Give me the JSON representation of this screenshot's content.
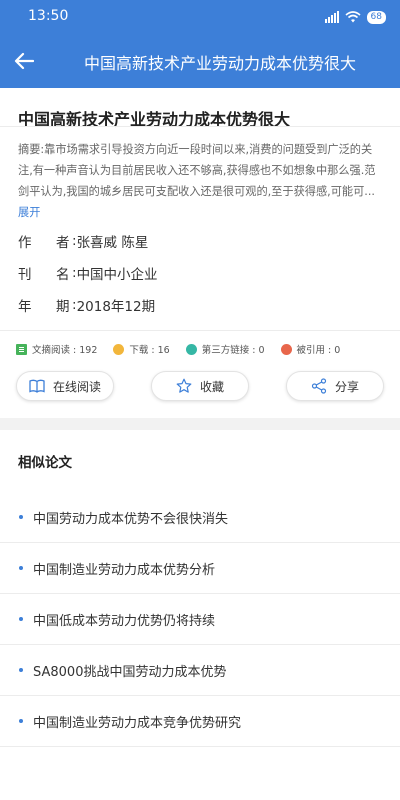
{
  "status_bar": {
    "time": "13:50",
    "battery": "68"
  },
  "app_bar": {
    "title": "中国高新技术产业劳动力成本优势很大"
  },
  "article": {
    "title": "中国高新技术产业劳动力成本优势很大",
    "abstract": "摘要:靠市场需求引导投资方向近一段时间以来,消费的问题受到广泛的关注,有一种声音认为目前居民收入还不够高,获得感也不如想象中那么强.范剑平认为,我国的城乡居民可支配收入还是很可观的,至于获得感,可能可...",
    "expand_label": "展开",
    "author_key_1": "作",
    "author_key_2": "者",
    "author_value": "张喜威 陈星",
    "journal_key_1": "刊",
    "journal_key_2": "名",
    "journal_value": "中国中小企业",
    "year_key_1": "年",
    "year_key_2": "期",
    "year_value": "2018年12期",
    "colon": ":"
  },
  "stats": {
    "reads": "文摘阅读 : 192",
    "downloads": "下载 : 16",
    "third_party": "第三方链接 : 0",
    "citations": "被引用 : 0"
  },
  "actions": {
    "read_online": "在线阅读",
    "favorite": "收藏",
    "share": "分享"
  },
  "related": {
    "title": "相似论文",
    "items": [
      "中国劳动力成本优势不会很快消失",
      "中国制造业劳动力成本优势分析",
      "中国低成本劳动力优势仍将持续",
      "SA8000挑战中国劳动力成本优势",
      "中国制造业劳动力成本竞争优势研究"
    ]
  },
  "colors": {
    "primary": "#3d7fd8",
    "divider": "#ececec"
  }
}
